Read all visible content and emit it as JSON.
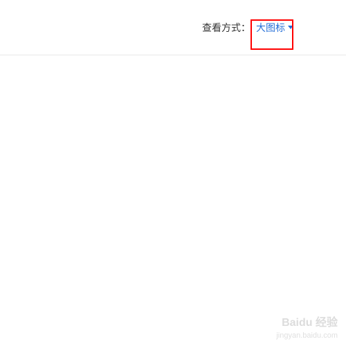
{
  "toolbar": {
    "view_mode_label": "查看方式：",
    "view_mode_value": "大图标"
  },
  "watermark": {
    "brand": "Baidu 经验",
    "url": "jingyan.baidu.com"
  },
  "colors": {
    "accent": "#2770d8",
    "highlight": "#ff0000",
    "border": "#e8e8e8"
  }
}
